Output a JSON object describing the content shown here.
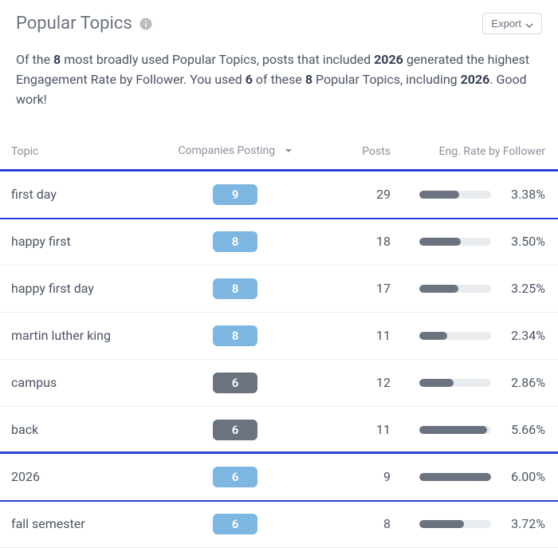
{
  "header": {
    "title": "Popular Topics",
    "export_label": "Export"
  },
  "summary": {
    "prefix": "Of the ",
    "total": "8",
    "mid1": " most broadly used Popular Topics, posts that included ",
    "top_topic": "2026",
    "mid2": " generated the highest Engagement Rate by Follower. You used ",
    "used_count": "6",
    "mid3": " of these ",
    "total2": "8",
    "mid4": " Popular Topics, including ",
    "top_topic2": "2026",
    "tail": ". Good work!"
  },
  "columns": {
    "topic": "Topic",
    "companies": "Companies Posting",
    "posts": "Posts",
    "rate": "Eng. Rate by Follower"
  },
  "rows": [
    {
      "topic": "first day",
      "companies": "9",
      "used": true,
      "posts": "29",
      "rate": "3.38%",
      "bar_pct": 56,
      "highlight": true
    },
    {
      "topic": "happy first",
      "companies": "8",
      "used": true,
      "posts": "18",
      "rate": "3.50%",
      "bar_pct": 58,
      "highlight": false
    },
    {
      "topic": "happy first day",
      "companies": "8",
      "used": true,
      "posts": "17",
      "rate": "3.25%",
      "bar_pct": 54,
      "highlight": false
    },
    {
      "topic": "martin luther king",
      "companies": "8",
      "used": true,
      "posts": "11",
      "rate": "2.34%",
      "bar_pct": 39,
      "highlight": false
    },
    {
      "topic": "campus",
      "companies": "6",
      "used": false,
      "posts": "12",
      "rate": "2.86%",
      "bar_pct": 48,
      "highlight": false
    },
    {
      "topic": "back",
      "companies": "6",
      "used": false,
      "posts": "11",
      "rate": "5.66%",
      "bar_pct": 94,
      "highlight": false
    },
    {
      "topic": "2026",
      "companies": "6",
      "used": true,
      "posts": "9",
      "rate": "6.00%",
      "bar_pct": 100,
      "highlight": true
    },
    {
      "topic": "fall semester",
      "companies": "6",
      "used": true,
      "posts": "8",
      "rate": "3.72%",
      "bar_pct": 62,
      "highlight": false
    }
  ]
}
